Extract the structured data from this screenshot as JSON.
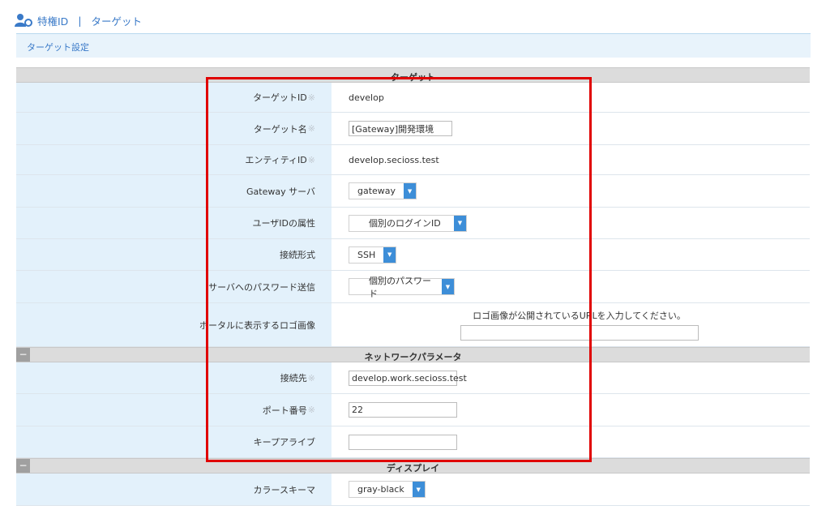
{
  "header": {
    "crumb_1": "特権ID",
    "separator": "|",
    "crumb_2": "ターゲット"
  },
  "subheader": {
    "title": "ターゲット設定"
  },
  "sections": {
    "target": "ターゲット",
    "network": "ネットワークパラメータ",
    "display": "ディスプレイ"
  },
  "toggle_symbol": "−",
  "required_mark": "※",
  "fields": {
    "target_id": {
      "label": "ターゲットID",
      "value": "develop"
    },
    "target_name": {
      "label": "ターゲット名",
      "value": "[Gateway]開発環境"
    },
    "entity_id": {
      "label": "エンティティID",
      "value": "develop.secioss.test"
    },
    "gateway_server": {
      "label": "Gateway サーバ",
      "value": "gateway"
    },
    "user_id_attr": {
      "label": "ユーザIDの属性",
      "value": "個別のログインID"
    },
    "connection_type": {
      "label": "接続形式",
      "value": "SSH"
    },
    "password_send": {
      "label": "サーバへのパスワード送信",
      "value": "個別のパスワード"
    },
    "portal_logo": {
      "label": "ポータルに表示するロゴ画像",
      "hint": "ロゴ画像が公開されているURLを入力してください。",
      "value": ""
    },
    "host": {
      "label": "接続先",
      "value": "develop.work.secioss.test"
    },
    "port": {
      "label": "ポート番号",
      "value": "22"
    },
    "keepalive": {
      "label": "キープアライブ",
      "value": ""
    },
    "color_scheme": {
      "label": "カラースキーマ",
      "value": "gray-black"
    }
  },
  "icons": {
    "user": "user-key-icon",
    "dropdown": "chevron-down-icon"
  },
  "colors": {
    "accent": "#3a7ac8",
    "label_bg": "#e3f1fb",
    "section_bg": "#dcdcdc",
    "dropdown_btn": "#3d8ed8",
    "highlight": "#e00000"
  }
}
